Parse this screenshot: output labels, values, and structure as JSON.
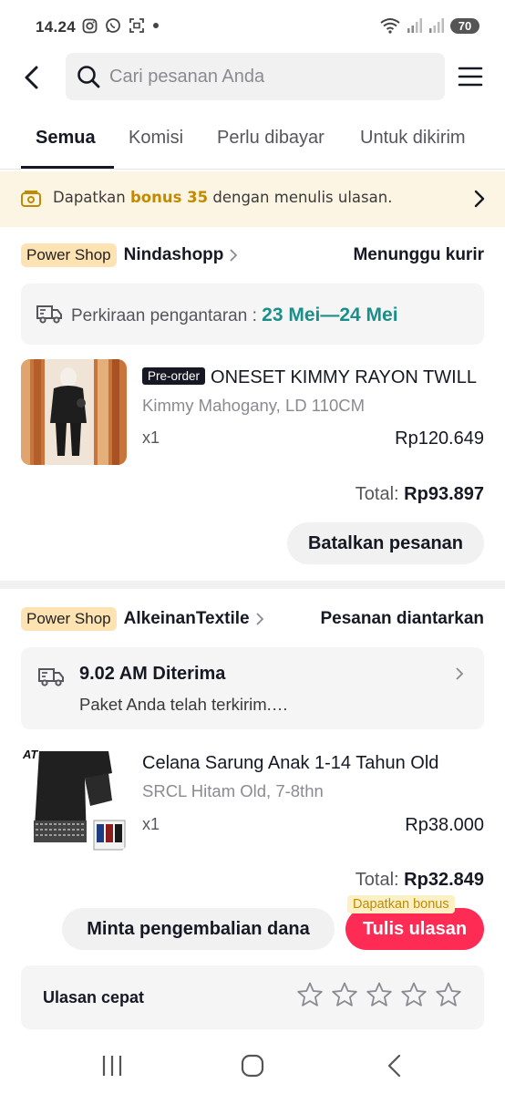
{
  "status_bar": {
    "time": "14.24",
    "battery": "70",
    "icons": [
      "instagram-icon",
      "whatsapp-icon",
      "screenshot-icon",
      "dot-icon",
      "wifi-icon",
      "signal-icon",
      "signal-icon"
    ]
  },
  "header": {
    "search_placeholder": "Cari pesanan Anda"
  },
  "tabs": [
    {
      "label": "Semua",
      "active": true
    },
    {
      "label": "Komisi",
      "active": false
    },
    {
      "label": "Perlu dibayar",
      "active": false
    },
    {
      "label": "Untuk dikirim",
      "active": false
    }
  ],
  "banner": {
    "prefix": "Dapatkan ",
    "highlight": "bonus 35",
    "suffix": " dengan menulis ulasan."
  },
  "orders": [
    {
      "badge": "Power Shop",
      "shop": "Nindashopp",
      "status": "Menunggu kurir",
      "delivery_label": "Perkiraan pengantaran : ",
      "delivery_date": "23 Mei—24 Mei",
      "product": {
        "tag": "Pre-order",
        "name": "ONESET KIMMY RAYON TWILL",
        "variant": "Kimmy Mahogany, LD 110CM",
        "qty": "x1",
        "price": "Rp120.649"
      },
      "total_label": "Total: ",
      "total_value": "Rp93.897",
      "action": "Batalkan pesanan"
    },
    {
      "badge": "Power Shop",
      "shop": "AlkeinanTextile",
      "status": "Pesanan diantarkan",
      "delivery_title": "9.02 AM Diterima",
      "delivery_sub": "Paket Anda telah terkirim.…",
      "product": {
        "name": "Celana Sarung Anak 1-14 Tahun Old",
        "variant": "SRCL Hitam Old, 7-8thn",
        "qty": "x1",
        "price": "Rp38.000"
      },
      "total_label": "Total: ",
      "total_value": "Rp32.849",
      "refund_action": "Minta pengembalian dana",
      "review_action": "Tulis ulasan",
      "bonus_tag": "Dapatkan bonus",
      "product_logo": "AT"
    }
  ],
  "quick_review": {
    "label": "Ulasan cepat",
    "stars": 5
  },
  "colors": {
    "accent_red": "#fe2c55",
    "delivery_teal": "#1a8f8a",
    "bonus_gold": "#c28a00",
    "power_badge": "#fde2b2"
  }
}
